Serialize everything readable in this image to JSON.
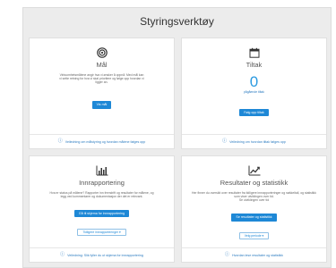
{
  "page": {
    "title": "Styringsverktøy"
  },
  "cards": {
    "mal": {
      "title": "Mål",
      "desc": "Virksomhetsmålene angir hva vi ønsker å oppnå. Med mål kan vi sette retning for hva vi skal prioritere og følge opp hvordan vi ligger an.",
      "button": "Vis mål",
      "footer": "Veiledning om målstyring og hvordan målene følges opp"
    },
    "tiltak": {
      "title": "Tiltak",
      "count": "0",
      "count_label": "pågående tiltak",
      "button": "Følg opp tiltak",
      "footer": "Veiledning om hvordan tiltak følges opp"
    },
    "innrapportering": {
      "title": "Innrapportering",
      "desc": "Hva er status på målene? Rapporter inn fremdrift og resultater for målene, og legg ved kommentarer og dokumentasjon der det er relevant.",
      "button": "Gå til skjema for innrapportering",
      "dropdown": "Tidligere innrapporteringer",
      "footer": "Veiledning: Slik fyller du ut skjema for innrapportering"
    },
    "resultater": {
      "title": "Resultater og statistikk",
      "desc": "Her finner du oversikt over resultater fra tidligere innrapporteringer og nøkkeltall, og statistikk som viser utviklingen over tid.",
      "desc2": "Se utviklingen over tid",
      "button": "Se resultater og statistikk",
      "dropdown": "Velg periode",
      "footer": "Hvordan lese resultater og statistikk"
    }
  }
}
